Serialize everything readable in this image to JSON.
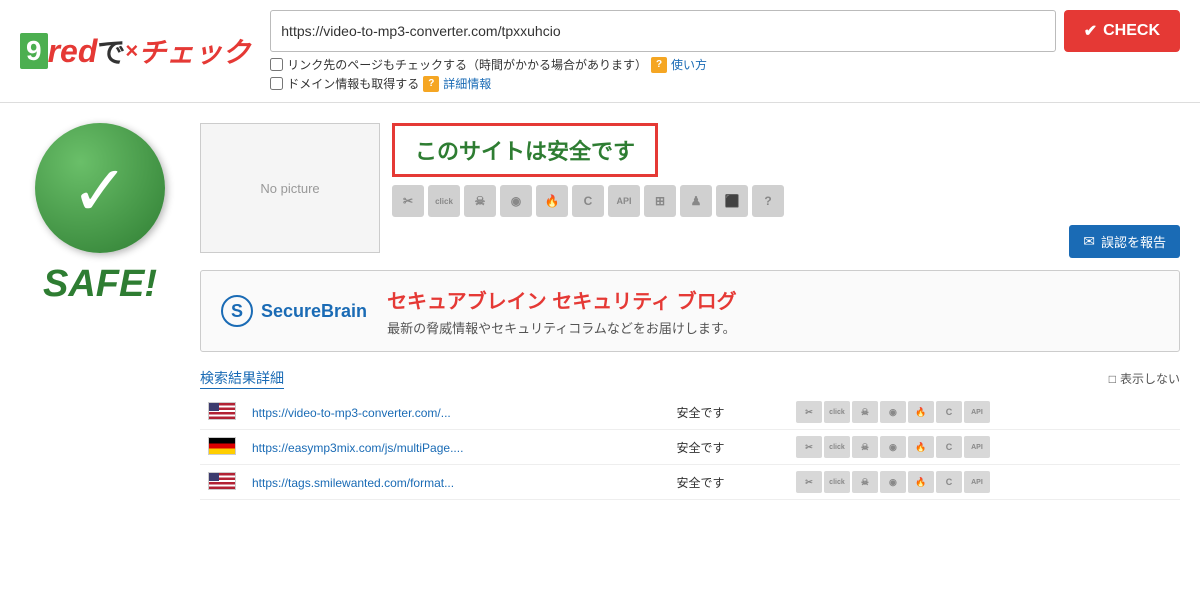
{
  "header": {
    "logo": {
      "num": "9",
      "brand": "red",
      "de": "で",
      "x": "×",
      "check_jp": "チェック"
    },
    "url_value": "https://video-to-mp3-converter.com/tpxxuhcio",
    "check_button_label": "CHECK",
    "option1": "リンク先のページもチェックする（時間がかかる場合があります）",
    "option1_link": "使い方",
    "option2": "ドメイン情報も取得する",
    "option2_link": "詳細情報"
  },
  "main": {
    "safe_label": "SAFE!",
    "no_picture": "No picture",
    "safe_banner_text": "このサイトは安全です",
    "report_button": "誤認を報告",
    "securebrain": {
      "name": "SecureBrain",
      "title": "セキュアブレイン セキュリティ ブログ",
      "subtitle": "最新の脅威情報やセキュリティコラムなどをお届けします。"
    },
    "results": {
      "title": "検索結果詳細",
      "hide_label": "表示しない",
      "rows": [
        {
          "flag": "us",
          "url": "https://video-to-mp3-converter.com/...",
          "status": "安全です"
        },
        {
          "flag": "de",
          "url": "https://easymp3mix.com/js/multiPage....",
          "status": "安全です"
        },
        {
          "flag": "us",
          "url": "https://tags.smilewanted.com/format...",
          "status": "安全です"
        }
      ]
    }
  },
  "icons": {
    "api_label": "API",
    "security_icon_labels": [
      "✂",
      "▲",
      "☠",
      "◉",
      "🔥",
      "C",
      "API",
      "⊞",
      "♟",
      "⬛",
      "?"
    ]
  }
}
